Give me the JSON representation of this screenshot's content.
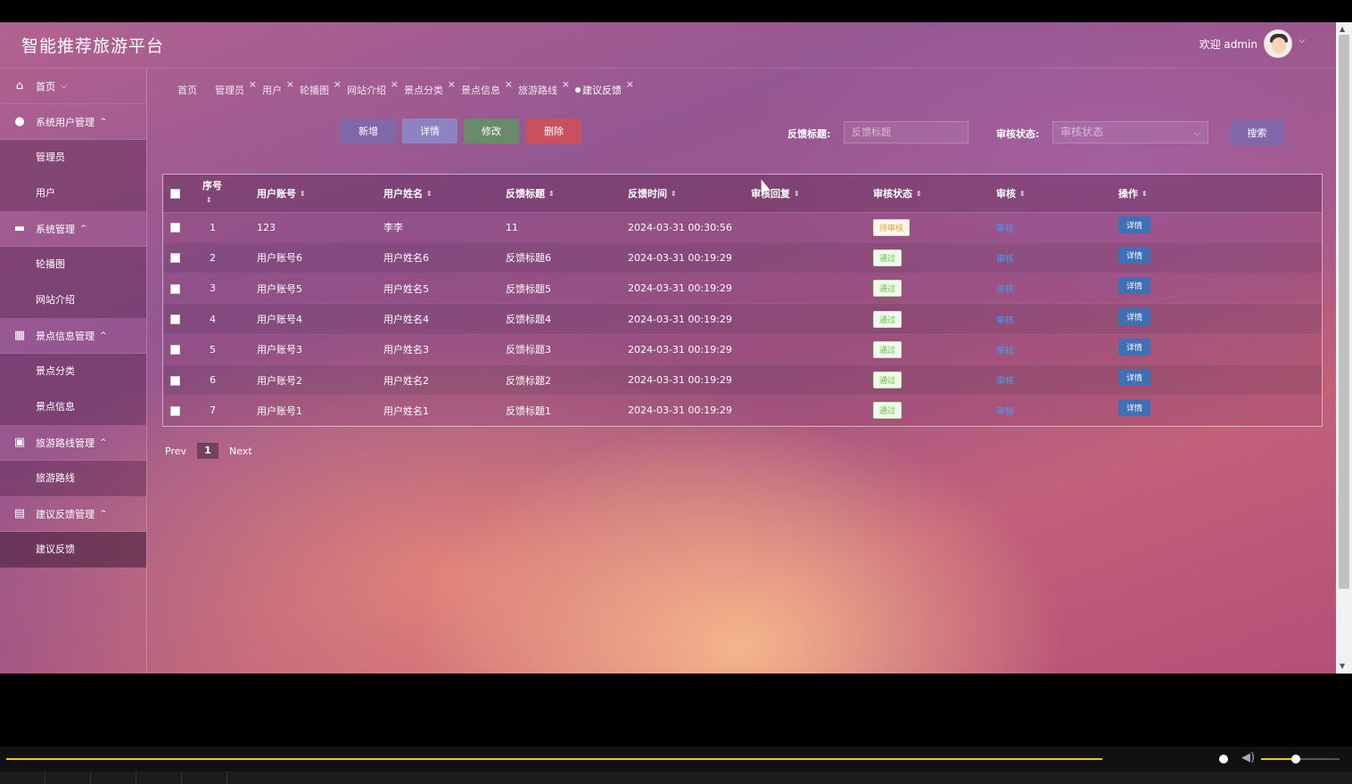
{
  "header": {
    "title": "智能推荐旅游平台",
    "welcome": "欢迎 admin"
  },
  "sidebar": {
    "home": "首页",
    "groups": [
      {
        "label": "系统用户管理",
        "items": [
          "管理员",
          "用户"
        ]
      },
      {
        "label": "系统管理",
        "items": [
          "轮播图",
          "网站介绍"
        ]
      },
      {
        "label": "景点信息管理",
        "items": [
          "景点分类",
          "景点信息"
        ]
      },
      {
        "label": "旅游路线管理",
        "items": [
          "旅游路线"
        ]
      },
      {
        "label": "建议反馈管理",
        "items": [
          "建议反馈"
        ]
      }
    ]
  },
  "tabs": [
    "首页",
    "管理员",
    "用户",
    "轮播图",
    "网站介绍",
    "景点分类",
    "景点信息",
    "旅游路线",
    "建议反馈"
  ],
  "toolbar": {
    "add": "新增",
    "detail": "详情",
    "edit": "修改",
    "delete": "删除"
  },
  "filters": {
    "title_label": "反馈标题:",
    "title_placeholder": "反馈标题",
    "status_label": "审核状态:",
    "status_placeholder": "审核状态",
    "search": "搜索"
  },
  "table": {
    "columns": [
      "序号",
      "用户账号",
      "用户姓名",
      "反馈标题",
      "反馈时间",
      "审核回复",
      "审核状态",
      "审核",
      "操作"
    ],
    "rows": [
      {
        "no": "1",
        "account": "123",
        "name": "李李",
        "title": "11",
        "time": "2024-03-31 00:30:56",
        "reply": "",
        "status": "待审核",
        "audit": "审核",
        "op": "详情"
      },
      {
        "no": "2",
        "account": "用户账号6",
        "name": "用户姓名6",
        "title": "反馈标题6",
        "time": "2024-03-31 00:19:29",
        "reply": "",
        "status": "通过",
        "audit": "审核",
        "op": "详情"
      },
      {
        "no": "3",
        "account": "用户账号5",
        "name": "用户姓名5",
        "title": "反馈标题5",
        "time": "2024-03-31 00:19:29",
        "reply": "",
        "status": "通过",
        "audit": "审核",
        "op": "详情"
      },
      {
        "no": "4",
        "account": "用户账号4",
        "name": "用户姓名4",
        "title": "反馈标题4",
        "time": "2024-03-31 00:19:29",
        "reply": "",
        "status": "通过",
        "audit": "审核",
        "op": "详情"
      },
      {
        "no": "5",
        "account": "用户账号3",
        "name": "用户姓名3",
        "title": "反馈标题3",
        "time": "2024-03-31 00:19:29",
        "reply": "",
        "status": "通过",
        "audit": "审核",
        "op": "详情"
      },
      {
        "no": "6",
        "account": "用户账号2",
        "name": "用户姓名2",
        "title": "反馈标题2",
        "time": "2024-03-31 00:19:29",
        "reply": "",
        "status": "通过",
        "audit": "审核",
        "op": "详情"
      },
      {
        "no": "7",
        "account": "用户账号1",
        "name": "用户姓名1",
        "title": "反馈标题1",
        "time": "2024-03-31 00:19:29",
        "reply": "",
        "status": "通过",
        "audit": "审核",
        "op": "详情"
      }
    ]
  },
  "pager": {
    "prev": "Prev",
    "page": "1",
    "next": "Next"
  },
  "colors": {
    "accent": "#8067a8",
    "delete": "#c9505d",
    "edit": "#6b8a6c",
    "pass": "#67c23a",
    "pending": "#e6a23c",
    "link": "#409eff"
  },
  "player": {
    "progress": 0.9,
    "volume": 0.43
  }
}
